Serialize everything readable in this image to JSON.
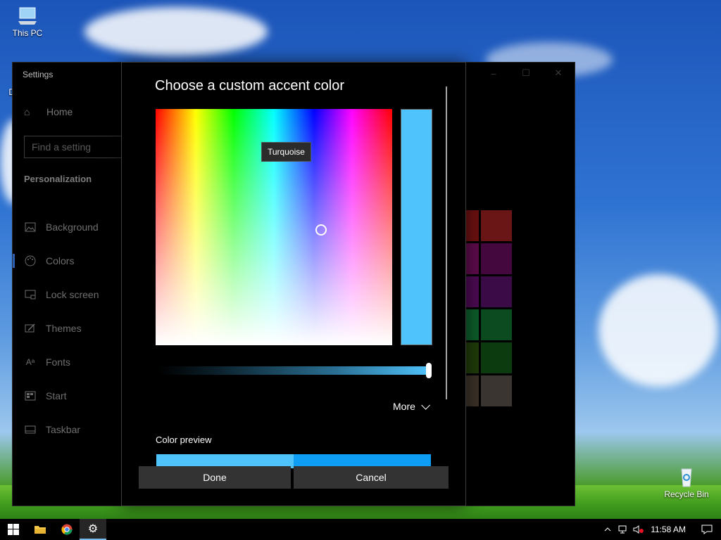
{
  "desktop": {
    "icons": [
      {
        "label": "This PC"
      },
      {
        "label": "Da"
      },
      {
        "label": "Recycle Bin"
      }
    ]
  },
  "settings_window": {
    "title": "Settings",
    "home_label": "Home",
    "search_placeholder": "Find a setting",
    "section": "Personalization",
    "nav_items": [
      {
        "label": "Background",
        "icon": "image-icon"
      },
      {
        "label": "Colors",
        "icon": "palette-icon",
        "selected": true
      },
      {
        "label": "Lock screen",
        "icon": "lock-screen-icon"
      },
      {
        "label": "Themes",
        "icon": "brush-icon"
      },
      {
        "label": "Fonts",
        "icon": "font-icon"
      },
      {
        "label": "Start",
        "icon": "start-icon"
      },
      {
        "label": "Taskbar",
        "icon": "taskbar-icon"
      }
    ],
    "swatches": [
      "#6b1010",
      "#6b1616",
      "#5c0b4a",
      "#45083e",
      "#4b0a51",
      "#3b0b47",
      "#0c5b2a",
      "#0b4b1f",
      "#1f3b0a",
      "#0d3b10",
      "#3a3127",
      "#3b3531"
    ]
  },
  "dialog": {
    "title": "Choose a custom accent color",
    "tooltip": "Turquoise",
    "selected_color": "#4fc3fb",
    "more_label": "More",
    "preview_label": "Color preview",
    "preview_colors": [
      "#4fc3fb",
      "#0e9ef5"
    ],
    "done_label": "Done",
    "cancel_label": "Cancel"
  },
  "taskbar": {
    "apps": [
      {
        "name": "start-icon"
      },
      {
        "name": "file-explorer-icon"
      },
      {
        "name": "chrome-icon"
      },
      {
        "name": "settings-icon",
        "active": true
      }
    ],
    "time": "11:58 AM"
  }
}
